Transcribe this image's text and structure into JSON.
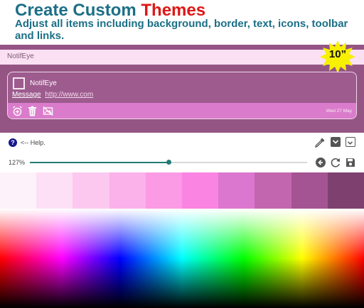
{
  "promo": {
    "title_part1": "Create Custom",
    "title_part2": "Themes",
    "subtitle": "Adjust all items including background, border, text, icons, toolbar and links.",
    "badge": "10”"
  },
  "preview": {
    "app_bar_title": "NotifEye",
    "card": {
      "app_name": "NotifEye",
      "message_label": "Message",
      "message_link": "http://www.com",
      "date": "Wed 27 May",
      "toolbar_icons": [
        "alarm-add-icon",
        "trash-icon",
        "hide-image-icon"
      ]
    }
  },
  "help": {
    "icon_glyph": "?",
    "text": "<-- Help."
  },
  "zoom": {
    "label": "127%",
    "slider_fraction": 0.5
  },
  "swatches": [
    "#fdf1fa",
    "#fde0f5",
    "#fcc8ef",
    "#fbb1ea",
    "#fb9ae5",
    "#fa84e2",
    "#db77cf",
    "#c366b0",
    "#a55493",
    "#7e416f"
  ],
  "colors": {
    "title_teal": "#1b6f86",
    "title_red": "#e01616",
    "preview_bg": "#945584",
    "app_bar": "#fbe0f3",
    "toolbar": "#da7ccb",
    "accent": "#227c74",
    "badge_yellow": "#f7f000"
  }
}
